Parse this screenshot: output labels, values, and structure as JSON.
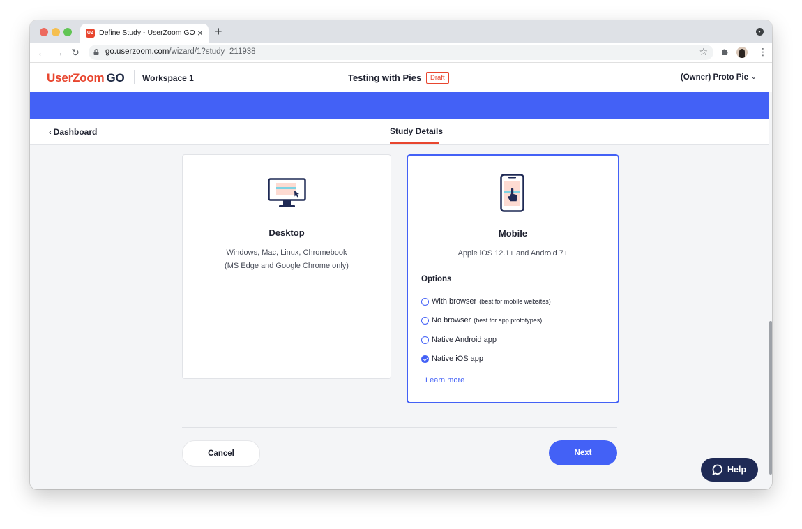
{
  "browser": {
    "tab_title": "Define Study - UserZoom GO",
    "tab_favicon": "UZ",
    "url_host": "go.userzoom.com",
    "url_path": "/wizard/1?study=211938"
  },
  "header": {
    "logo_text": "UserZoom",
    "logo_go": "GO",
    "workspace": "Workspace 1",
    "study_title": "Testing with Pies",
    "status_badge": "Draft",
    "owner": "(Owner) Proto Pie"
  },
  "subnav": {
    "back_label": "Dashboard",
    "active_tab": "Study Details"
  },
  "cards": {
    "desktop": {
      "title": "Desktop",
      "desc_line1": "Windows, Mac, Linux, Chromebook",
      "desc_line2": "(MS Edge and Google Chrome only)"
    },
    "mobile": {
      "title": "Mobile",
      "desc": "Apple iOS 12.1+ and Android 7+",
      "options_label": "Options",
      "options": [
        {
          "label": "With browser",
          "note": "(best for mobile websites)",
          "checked": false
        },
        {
          "label": "No browser",
          "note": "(best for app prototypes)",
          "checked": false
        },
        {
          "label": "Native Android app",
          "note": "",
          "checked": false
        },
        {
          "label": "Native iOS app",
          "note": "",
          "checked": true
        }
      ],
      "learn_more": "Learn more"
    }
  },
  "footer": {
    "cancel_label": "Cancel",
    "next_label": "Next"
  },
  "help": {
    "label": "Help"
  },
  "colors": {
    "brand_orange": "#e8462f",
    "accent_blue": "#4361f6",
    "navy": "#1f2a55"
  }
}
